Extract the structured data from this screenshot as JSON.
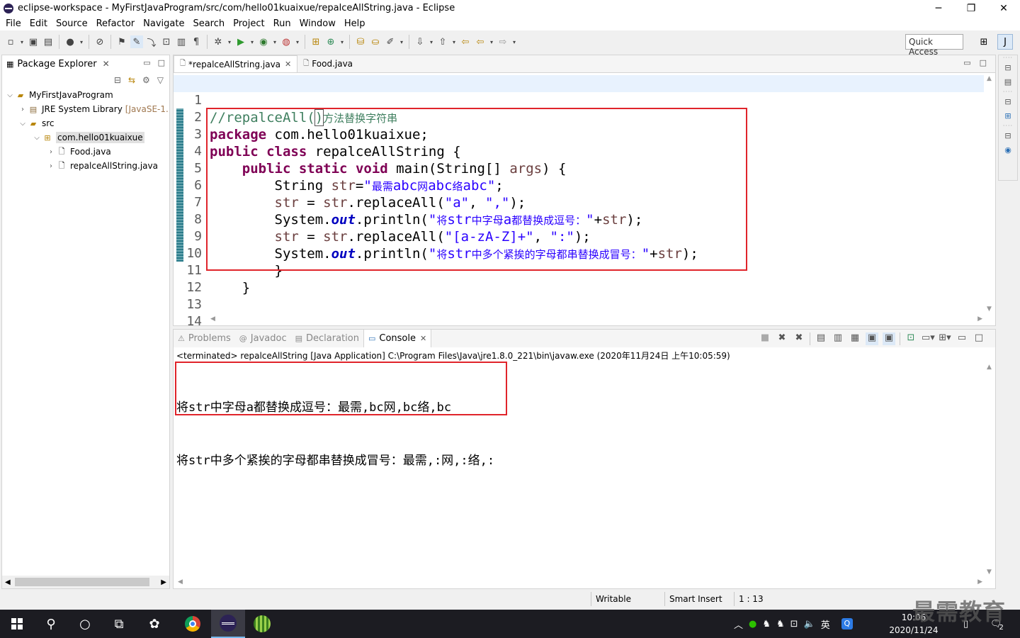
{
  "window": {
    "title": "eclipse-workspace - MyFirstJavaProgram/src/com/hello01kuaixue/repalceAllString.java - Eclipse",
    "minimize": "─",
    "maximize": "❐",
    "close": "✕"
  },
  "menu": [
    "File",
    "Edit",
    "Source",
    "Refactor",
    "Navigate",
    "Search",
    "Project",
    "Run",
    "Window",
    "Help"
  ],
  "toolbar": {
    "quick_access_placeholder": "Quick Access"
  },
  "package_explorer": {
    "title": "Package Explorer",
    "tree": [
      {
        "label": "MyFirstJavaProgram",
        "icon": "project-icon",
        "arrow": "⌵"
      },
      {
        "label": "JRE System Library",
        "extra": "[JavaSE-1.",
        "icon": "library-icon",
        "arrow": "›"
      },
      {
        "label": "src",
        "icon": "source-folder-icon",
        "arrow": "⌵"
      },
      {
        "label": "com.hello01kuaixue",
        "icon": "package-icon",
        "arrow": "⌵"
      },
      {
        "label": "Food.java",
        "icon": "java-file-icon",
        "arrow": "›"
      },
      {
        "label": "repalceAllString.java",
        "icon": "java-file-icon",
        "arrow": "›"
      }
    ]
  },
  "editor": {
    "tabs": [
      {
        "label": "*repalceAllString.java",
        "active": true
      },
      {
        "label": "Food.java",
        "active": false
      }
    ],
    "lines": [
      {
        "n": "1",
        "t": "cmt",
        "text": "//repalceAll()方法替换字符串"
      },
      {
        "n": "2",
        "text": "package com.hello01kuaixue;"
      },
      {
        "n": "3",
        "text": "public class repalceAllString {"
      },
      {
        "n": "4",
        "text": "    public static void main(String[] args) {"
      },
      {
        "n": "5",
        "text": "        String str=\"最需abc网abc络abc\";"
      },
      {
        "n": "6",
        "text": "        str = str.replaceAll(\"a\", \",\");"
      },
      {
        "n": "7",
        "text": "        System.out.println(\"将str中字母a都替换成逗号：\"+str);"
      },
      {
        "n": "8",
        "text": "        str = str.replaceAll(\"[a-zA-Z]+\", \":\");"
      },
      {
        "n": "9",
        "text": "        System.out.println(\"将str中多个紧挨的字母都串替换成冒号：\"+str);"
      },
      {
        "n": "10",
        "text": "        }"
      },
      {
        "n": "11",
        "text": "    }"
      },
      {
        "n": "12",
        "text": ""
      },
      {
        "n": "13",
        "text": ""
      },
      {
        "n": "14",
        "text": ""
      }
    ]
  },
  "console": {
    "tabs": [
      "Problems",
      "Javadoc",
      "Declaration",
      "Console"
    ],
    "header": "<terminated> repalceAllString [Java Application] C:\\Program Files\\Java\\jre1.8.0_221\\bin\\javaw.exe (2020年11月24日 上午10:05:59)",
    "output": [
      "将str中字母a都替换成逗号：最需,bc网,bc络,bc",
      "将str中多个紧挨的字母都串替换成冒号：最需,:网,:络,:"
    ]
  },
  "status": {
    "writable": "Writable",
    "insert_mode": "Smart Insert",
    "position": "1 : 13"
  },
  "taskbar": {
    "time": "10:06",
    "date": "2020/11/24",
    "ime": "英",
    "notifications": "2"
  },
  "watermark": "最需教育"
}
